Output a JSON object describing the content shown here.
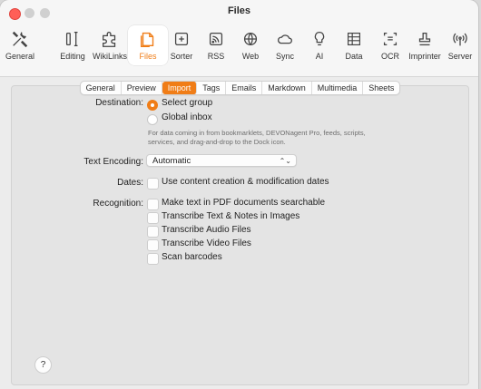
{
  "window": {
    "title": "Files"
  },
  "toolbar": [
    {
      "name": "general",
      "label": "General",
      "icon": "tools-icon"
    },
    {
      "name": "editing",
      "label": "Editing",
      "icon": "text-cursor-icon"
    },
    {
      "name": "wikilinks",
      "label": "WikiLinks",
      "icon": "puzzle-icon"
    },
    {
      "name": "files",
      "label": "Files",
      "icon": "files-icon",
      "active": true
    },
    {
      "name": "sorter",
      "label": "Sorter",
      "icon": "tray-in-icon"
    },
    {
      "name": "rss",
      "label": "RSS",
      "icon": "rss-icon"
    },
    {
      "name": "web",
      "label": "Web",
      "icon": "globe-icon"
    },
    {
      "name": "sync",
      "label": "Sync",
      "icon": "cloud-icon"
    },
    {
      "name": "ai",
      "label": "AI",
      "icon": "lightbulb-icon"
    },
    {
      "name": "data",
      "label": "Data",
      "icon": "table-icon"
    },
    {
      "name": "ocr",
      "label": "OCR",
      "icon": "doc-scan-icon"
    },
    {
      "name": "imprinter",
      "label": "Imprinter",
      "icon": "stamp-icon"
    },
    {
      "name": "server",
      "label": "Server",
      "icon": "broadcast-icon"
    }
  ],
  "tabs": [
    "General",
    "Preview",
    "Import",
    "Tags",
    "Emails",
    "Markdown",
    "Multimedia",
    "Sheets"
  ],
  "selected_tab": "Import",
  "destination": {
    "label": "Destination:",
    "options": [
      "Select group",
      "Global inbox"
    ],
    "selected": "Select group",
    "note": "For data coming in from bookmarklets, DEVONagent Pro, feeds, scripts, services, and drag-and-drop to the Dock icon."
  },
  "encoding": {
    "label": "Text Encoding:",
    "value": "Automatic"
  },
  "dates": {
    "label": "Dates:",
    "option": "Use content creation & modification dates"
  },
  "recognition": {
    "label": "Recognition:",
    "options": [
      "Make text in PDF documents searchable",
      "Transcribe Text & Notes in Images",
      "Transcribe Audio Files",
      "Transcribe Video Files",
      "Scan barcodes"
    ]
  },
  "help": {
    "label": "?"
  },
  "colors": {
    "accent": "#f07d17",
    "close": "#ff5f57"
  }
}
